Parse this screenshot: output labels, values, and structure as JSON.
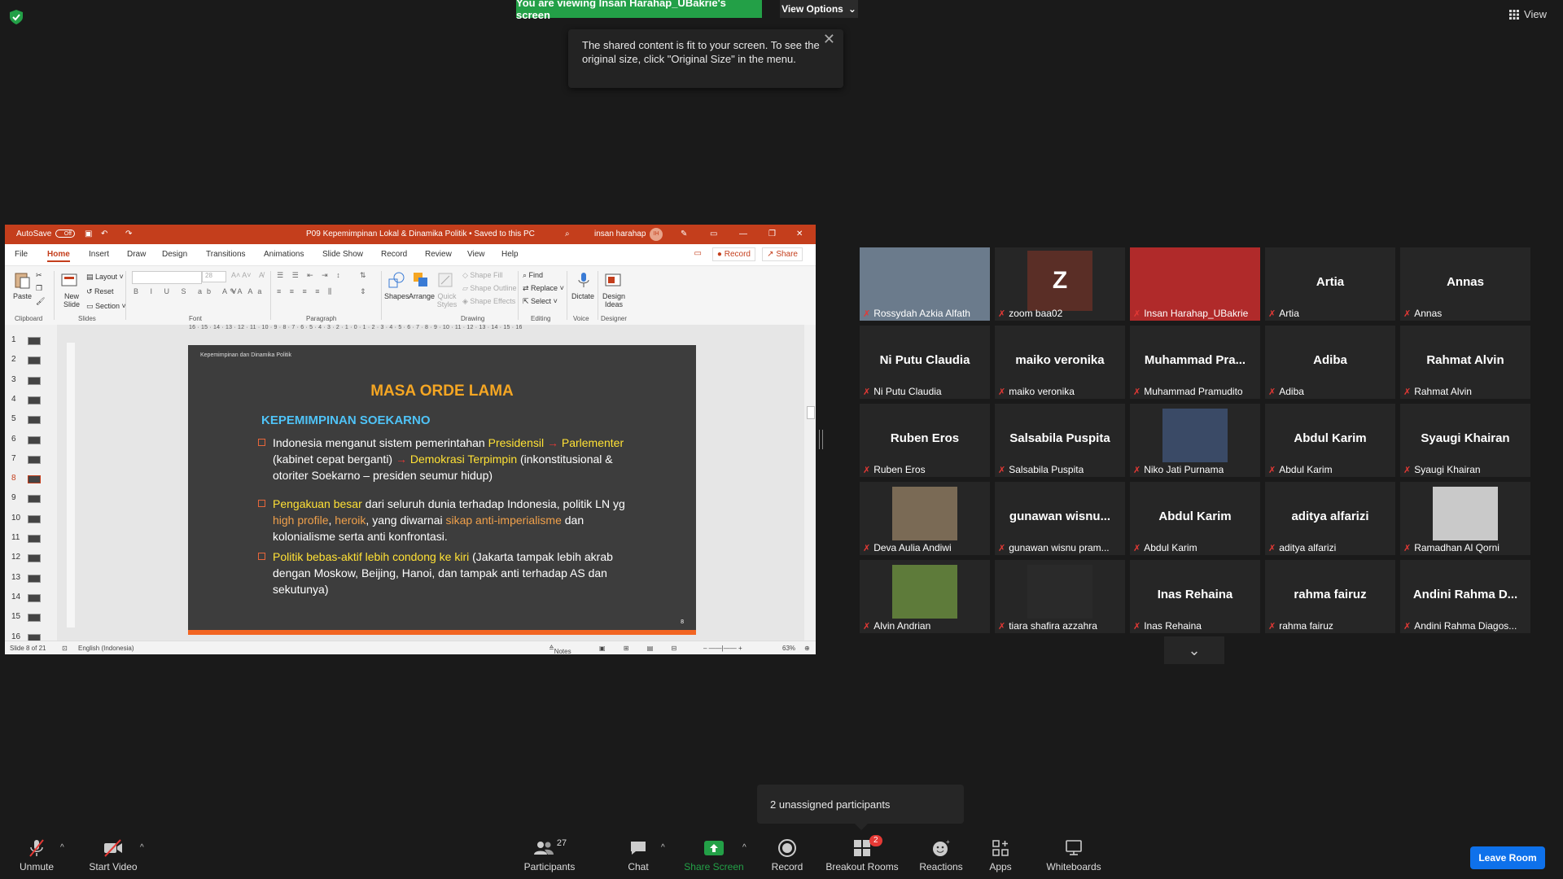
{
  "banner": {
    "viewing": "You are viewing Insan Harahap_UBakrie's screen",
    "view_options": "View Options",
    "view_button": "View"
  },
  "notice": {
    "text": "The shared content is fit to your screen. To see the original size, click \"Original Size\" in the menu."
  },
  "ppt": {
    "autosave": "AutoSave",
    "autosave_state": "Off",
    "doc_title": "P09 Kepemimpinan Lokal & Dinamika Politik • Saved to this PC",
    "user": "insan harahap",
    "user_initials": "IH",
    "menu": [
      "File",
      "Home",
      "Insert",
      "Draw",
      "Design",
      "Transitions",
      "Animations",
      "Slide Show",
      "Record",
      "Review",
      "View",
      "Help"
    ],
    "record_btn": "Record",
    "share_btn": "Share",
    "ribbon": {
      "paste": "Paste",
      "clipboard": "Clipboard",
      "new_slide": "New Slide",
      "layout": "Layout",
      "reset": "Reset",
      "section": "Section",
      "slides": "Slides",
      "font": "Font",
      "paragraph": "Paragraph",
      "shapes": "Shapes",
      "arrange": "Arrange",
      "quick_styles": "Quick Styles",
      "shape_fill": "Shape Fill",
      "shape_outline": "Shape Outline",
      "shape_effects": "Shape Effects",
      "drawing": "Drawing",
      "find": "Find",
      "replace": "Replace",
      "select": "Select",
      "editing": "Editing",
      "dictate": "Dictate",
      "voice": "Voice",
      "design_ideas": "Design Ideas",
      "designer": "Designer",
      "font_size": "28"
    },
    "ruler": "16 · 15 · 14 · 13 · 12 · 11 · 10 · 9 · 8 · 7 · 6 · 5 · 4 · 3 · 2 · 1 · 0 · 1 · 2 · 3 · 4 · 5 · 6 · 7 · 8 · 9 · 10 · 11 · 12 · 13 · 14 · 15 · 16",
    "thumb_numbers": [
      "1",
      "2",
      "3",
      "4",
      "5",
      "6",
      "7",
      "8",
      "9",
      "10",
      "11",
      "12",
      "13",
      "14",
      "15",
      "16"
    ],
    "current_thumb": "8",
    "slide": {
      "header": "Kepemimpinan dan Dinamika Politik",
      "title": "MASA ORDE LAMA",
      "subtitle": "KEPEMIMPINAN SOEKARNO",
      "b1_a": "Indonesia menganut sistem pemerintahan ",
      "b1_b": "Presidensil",
      "b1_c": "Parlementer",
      "b1_d": " (kabinet cepat berganti) ",
      "b1_e": "Demokrasi Terpimpin",
      "b1_f": " (inkonstitusional & otoriter Soekarno – presiden seumur hidup)",
      "b2_a": "Pengakuan besar",
      "b2_b": " dari seluruh dunia terhadap Indonesia, politik LN yg ",
      "b2_c": "high profile",
      "b2_d": ", ",
      "b2_e": "heroik",
      "b2_f": ", yang diwarnai ",
      "b2_g": "sikap anti-imperialisme",
      "b2_h": " dan kolonialisme serta anti konfrontasi.",
      "b3_a": "Politik bebas-aktif lebih condong  ke kiri",
      "b3_b": " (Jakarta tampak lebih akrab dengan Moskow, Beijing, Hanoi, dan tampak anti terhadap AS dan sekutunya)",
      "arrow": "→",
      "page": "8"
    },
    "status": {
      "slide_of": "Slide 8 of 21",
      "language": "English (Indonesia)",
      "notes": "Notes",
      "zoom": "63%"
    }
  },
  "participants": [
    {
      "name": "Rossydah Azkia Alfath",
      "label": "",
      "photo": true
    },
    {
      "name": "zoom baa02",
      "label": "Z",
      "avatar": true
    },
    {
      "name": "Insan Harahap_UBakrie",
      "label": "",
      "photo": true,
      "active": true
    },
    {
      "name": "Artia",
      "label": "Artia"
    },
    {
      "name": "Annas",
      "label": "Annas"
    },
    {
      "name": "Ni Putu Claudia",
      "label": "Ni Putu Claudia"
    },
    {
      "name": "maiko veronika",
      "label": "maiko veronika"
    },
    {
      "name": "Muhammad Pramudito",
      "label": "Muhammad  Pra..."
    },
    {
      "name": "Adiba",
      "label": "Adiba"
    },
    {
      "name": "Rahmat Alvin",
      "label": "Rahmat Alvin"
    },
    {
      "name": "Ruben Eros",
      "label": "Ruben Eros"
    },
    {
      "name": "Salsabila Puspita",
      "label": "Salsabila Puspita"
    },
    {
      "name": "Niko Jati Purnama",
      "label": "",
      "photo": true
    },
    {
      "name": "Abdul Karim",
      "label": "Abdul Karim"
    },
    {
      "name": "Syaugi Khairan",
      "label": "Syaugi Khairan"
    },
    {
      "name": "Deva Aulia Andiwi",
      "label": "",
      "photo": true
    },
    {
      "name": "gunawan wisnu pram...",
      "label": "gunawan  wisnu..."
    },
    {
      "name": "Abdul Karim",
      "label": "Abdul Karim"
    },
    {
      "name": "aditya alfarizi",
      "label": "aditya alfarizi"
    },
    {
      "name": "Ramadhan Al Qorni",
      "label": "",
      "photo": true
    },
    {
      "name": "Alvin Andrian",
      "label": "",
      "photo": true
    },
    {
      "name": "tiara shafira azzahra",
      "label": "",
      "photo": true
    },
    {
      "name": "Inas Rehaina",
      "label": "Inas Rehaina"
    },
    {
      "name": "rahma fairuz",
      "label": "rahma fairuz"
    },
    {
      "name": "Andini Rahma Diagos...",
      "label": "Andini  Rahma  D..."
    }
  ],
  "unassigned": "2 unassigned participants",
  "toolbar": {
    "unmute": "Unmute",
    "start_video": "Start Video",
    "participants": "Participants",
    "participants_count": "27",
    "chat": "Chat",
    "share_screen": "Share Screen",
    "record": "Record",
    "breakout": "Breakout Rooms",
    "breakout_badge": "2",
    "reactions": "Reactions",
    "apps": "Apps",
    "whiteboards": "Whiteboards",
    "leave": "Leave Room"
  },
  "colors": {
    "share_green": "#23a047",
    "leave_blue": "#0e71eb",
    "ppt_red": "#c43e1c",
    "active_yellow": "#ffd200",
    "muted_red": "#e53935"
  }
}
